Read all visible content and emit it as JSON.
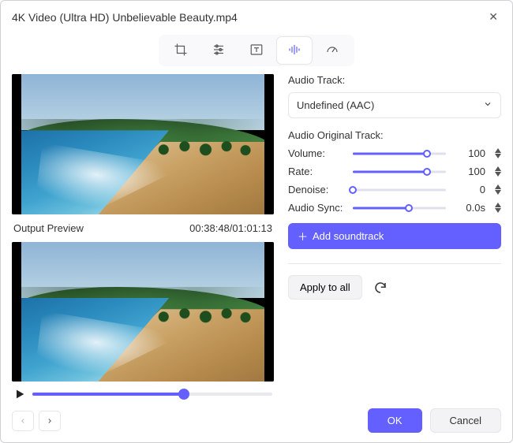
{
  "title": "4K Video (Ultra HD) Unbelievable Beauty.mp4",
  "toolbar": {
    "crop_icon": "crop-icon",
    "adjust_icon": "sliders-icon",
    "text_icon": "text-icon",
    "audio_icon": "audio-waveform-icon",
    "speed_icon": "speedometer-icon",
    "active": "audio"
  },
  "preview": {
    "output_label": "Output Preview",
    "timecode": "00:38:48/01:01:13",
    "progress_pct": 63
  },
  "panel": {
    "audio_track_label": "Audio Track:",
    "audio_track_value": "Undefined (AAC)",
    "original_track_label": "Audio Original Track:",
    "controls": [
      {
        "key": "volume",
        "label": "Volume:",
        "value": "100",
        "pct": 80
      },
      {
        "key": "rate",
        "label": "Rate:",
        "value": "100",
        "pct": 80
      },
      {
        "key": "denoise",
        "label": "Denoise:",
        "value": "0",
        "pct": 0
      },
      {
        "key": "audiosync",
        "label": "Audio Sync:",
        "value": "0.0s",
        "pct": 60
      }
    ],
    "add_soundtrack_label": "Add soundtrack",
    "apply_all_label": "Apply to all"
  },
  "footer": {
    "ok_label": "OK",
    "cancel_label": "Cancel"
  }
}
